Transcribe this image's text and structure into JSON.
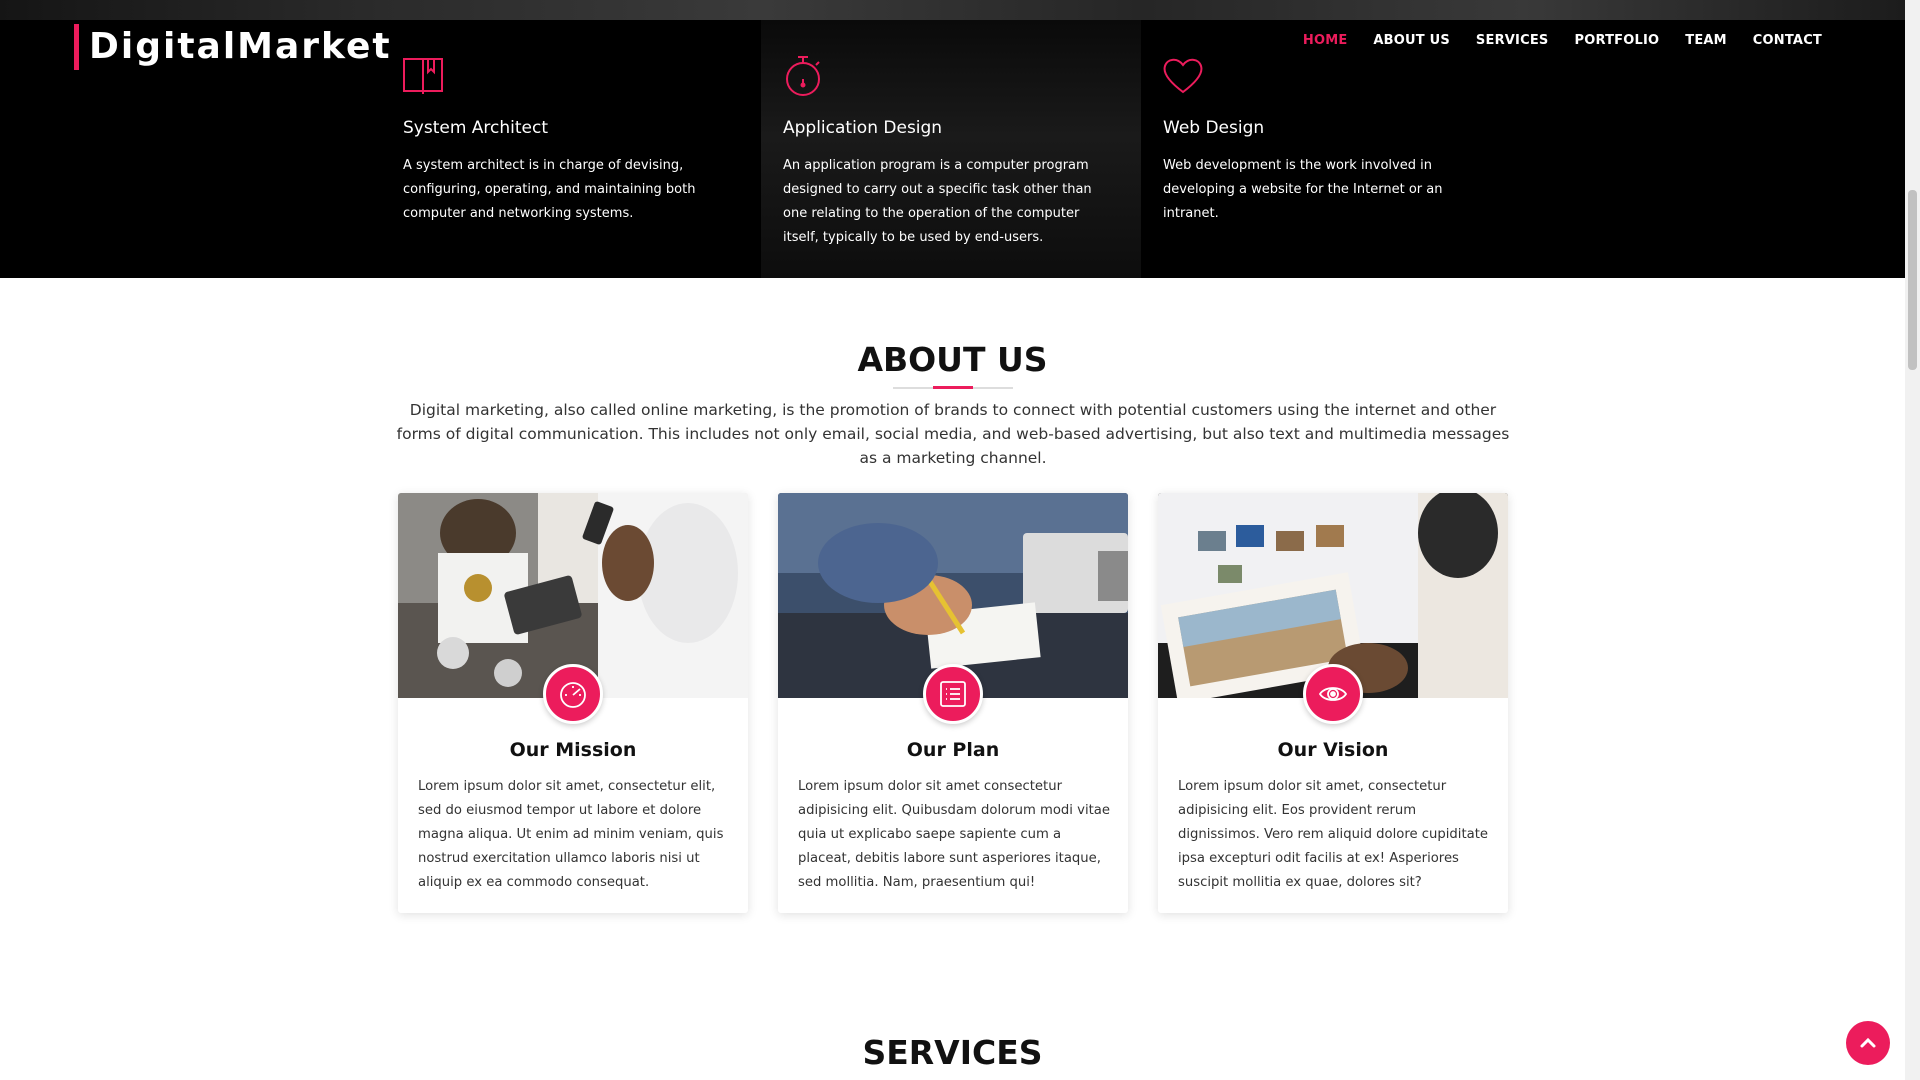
{
  "brand": {
    "name": "DigitalMarket"
  },
  "nav": {
    "items": [
      {
        "label": "HOME",
        "active": true
      },
      {
        "label": "ABOUT US",
        "active": false
      },
      {
        "label": "SERVICES",
        "active": false
      },
      {
        "label": "PORTFOLIO",
        "active": false
      },
      {
        "label": "TEAM",
        "active": false
      },
      {
        "label": "CONTACT",
        "active": false
      }
    ]
  },
  "features": [
    {
      "icon": "book-icon",
      "title": "System Architect",
      "text": "A system architect is in charge of devising, configuring, operating, and maintaining both computer and networking systems."
    },
    {
      "icon": "stopwatch-icon",
      "title": "Application Design",
      "text": "An application program is a computer program designed to carry out a specific task other than one relating to the operation of the computer itself, typically to be used by end-users."
    },
    {
      "icon": "heart-icon",
      "title": "Web Design",
      "text": "Web development is the work involved in developing a website for the Internet or an intranet."
    }
  ],
  "about": {
    "title": "ABOUT US",
    "text": "Digital marketing, also called online marketing, is the promotion of brands to connect with potential customers using the internet and other forms of digital communication. This includes not only email, social media, and web-based advertising, but also text and multimedia messages as a marketing channel.",
    "cards": [
      {
        "icon": "speedometer-icon",
        "title": "Our Mission",
        "text": "Lorem ipsum dolor sit amet, consectetur elit, sed do eiusmod tempor ut labore et dolore magna aliqua. Ut enim ad minim veniam, quis nostrud exercitation ullamco laboris nisi ut aliquip ex ea commodo consequat."
      },
      {
        "icon": "list-icon",
        "title": "Our Plan",
        "text": "Lorem ipsum dolor sit amet consectetur adipisicing elit. Quibusdam dolorum modi vitae quia ut explicabo saepe sapiente cum a placeat, debitis labore sunt asperiores itaque, sed mollitia. Nam, praesentium qui!"
      },
      {
        "icon": "eye-icon",
        "title": "Our Vision",
        "text": "Lorem ipsum dolor sit amet, consectetur adipisicing elit. Eos provident rerum dignissimos. Vero rem aliquid dolore cupiditate ipsa excepturi odit facilis at ex! Asperiores suscipit mollitia ex quae, dolores sit?"
      }
    ]
  },
  "services": {
    "title": "SERVICES"
  },
  "colors": {
    "accent": "#ec1c5c",
    "hero_bg": "#000000"
  }
}
